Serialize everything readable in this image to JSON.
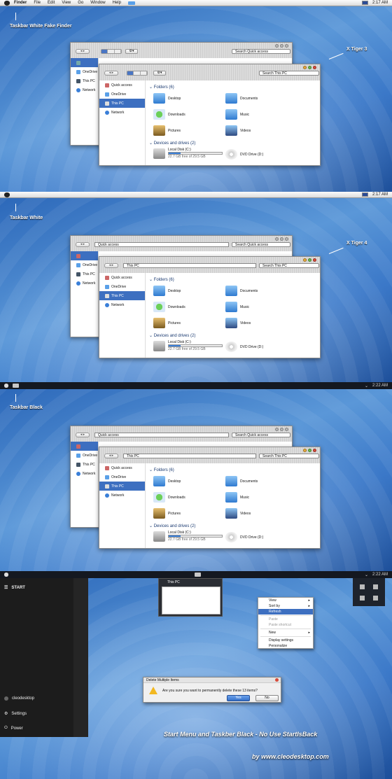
{
  "menubar": {
    "app": "Finder",
    "items": [
      "File",
      "Edit",
      "View",
      "Go",
      "Window",
      "Help"
    ],
    "time": "2:17 AM"
  },
  "blackbar": {
    "time": "2:22 AM"
  },
  "annotations": {
    "p1_left": "Taskbar White Fake Finder",
    "p1_right": "X Tiger 3",
    "p2_left": "Taskbar White",
    "p2_right": "X Tiger 4",
    "p3_left": "Taskbar Black",
    "footer": "Start Menu and Taskber Black - No Use StartIsBack",
    "site": "by www.cleodesktop.com"
  },
  "explorer": {
    "back_address": "Quick access",
    "back_search": "Search Quick access",
    "front_address": "This PC",
    "front_search": "Search This PC",
    "sidebar": [
      "Quick access",
      "OneDrive",
      "This PC",
      "Network"
    ],
    "back_sidebar": [
      "Quick access",
      "OneDrive",
      "This PC",
      "Network"
    ],
    "folders_title": "Folders (6)",
    "folders": [
      "Desktop",
      "Documents",
      "Downloads",
      "Music",
      "Pictures",
      "Videos"
    ],
    "devices_title": "Devices and drives (2)",
    "local_disk": "Local Disk (C:)",
    "local_free": "22.7 GB free of 29.5 GB",
    "local_fill": 0.23,
    "dvd": "DVD Drive (D:)"
  },
  "colors": {
    "accent": "#3d6fc0",
    "folder": "#5aa0e8",
    "green": "#4aa83c",
    "brown": "#c8a050"
  },
  "startmenu": {
    "title": "START",
    "user": "cleodesktop",
    "settings": "Settings",
    "power": "Power"
  },
  "thumb": {
    "title": "This PC"
  },
  "context": {
    "items": [
      "View",
      "Sort by",
      "Refresh",
      "Paste",
      "Paste shortcut",
      "New",
      "Display settings",
      "Personalize"
    ]
  },
  "dialog": {
    "title": "Delete Multiple Items",
    "message": "Are you sure you want to permanently delete these 13 items?",
    "yes": "Yes",
    "no": "No"
  }
}
